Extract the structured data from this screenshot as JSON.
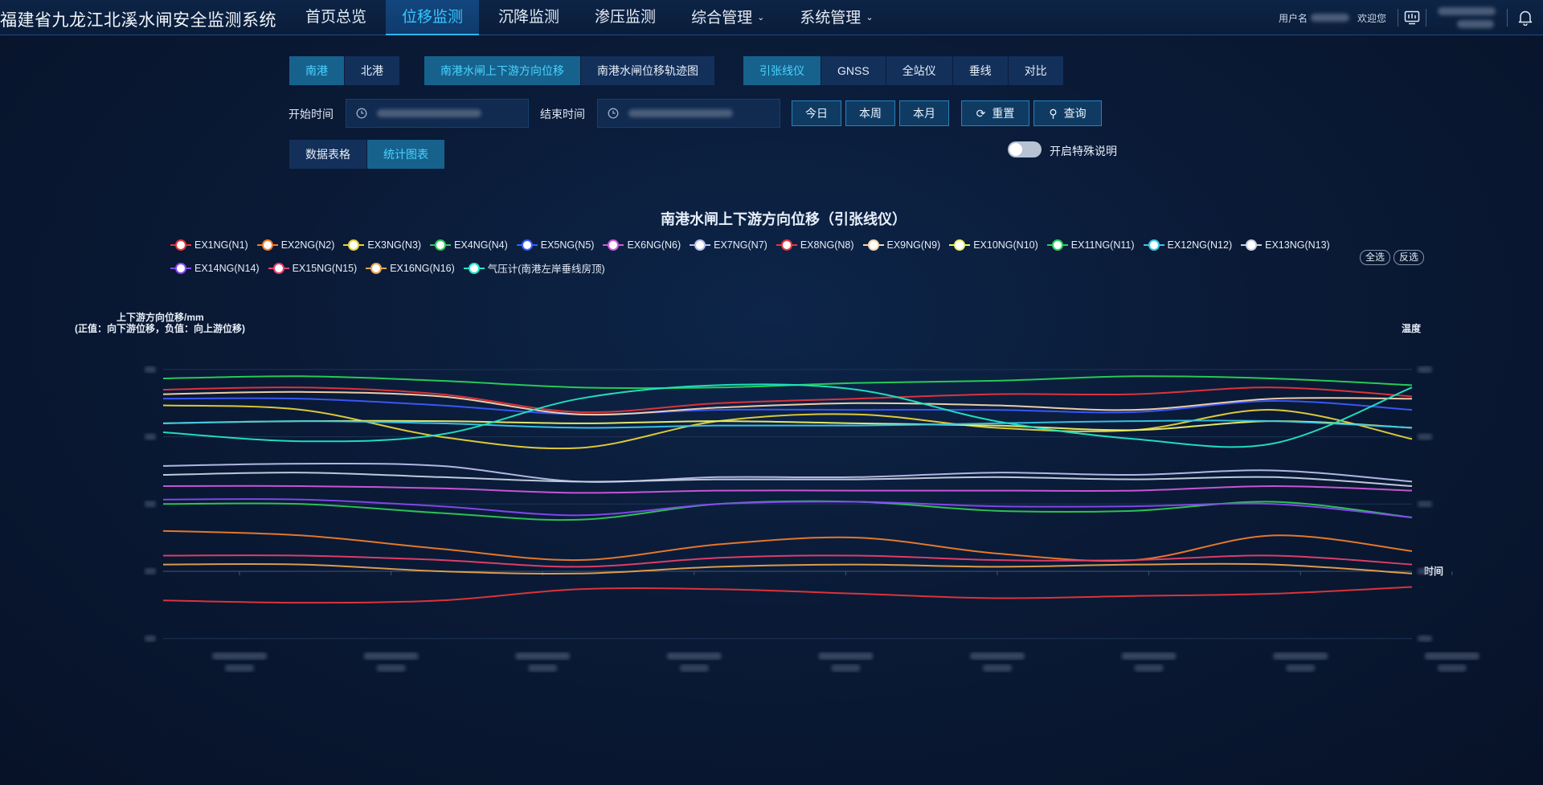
{
  "app": {
    "title": "福建省九龙江北溪水闸安全监测系统"
  },
  "nav": {
    "items": [
      {
        "label": "首页总览",
        "active": false,
        "dropdown": false
      },
      {
        "label": "位移监测",
        "active": true,
        "dropdown": false
      },
      {
        "label": "沉降监测",
        "active": false,
        "dropdown": false
      },
      {
        "label": "渗压监测",
        "active": false,
        "dropdown": false
      },
      {
        "label": "综合管理",
        "active": false,
        "dropdown": true
      },
      {
        "label": "系统管理",
        "active": false,
        "dropdown": true
      }
    ]
  },
  "header": {
    "user_label": "用户名",
    "welcome": "欢迎您",
    "icons": [
      "monitor-icon",
      "bell-icon"
    ]
  },
  "filters": {
    "port_tabs": [
      "南港",
      "北港"
    ],
    "port_active": 0,
    "view_tabs": [
      "南港水闸上下游方向位移",
      "南港水闸位移轨迹图"
    ],
    "view_active": 0,
    "instrument_tabs": [
      "引张线仪",
      "GNSS",
      "全站仪",
      "垂线",
      "对比"
    ],
    "instrument_active": 0,
    "start_label": "开始时间",
    "end_label": "结束时间",
    "quick_buttons": [
      "今日",
      "本周",
      "本月"
    ],
    "reset_label": "重置",
    "query_label": "查询",
    "display_tabs": [
      "数据表格",
      "统计图表"
    ],
    "display_active": 1,
    "toggle_label": "开启特殊说明",
    "toggle_on": false
  },
  "chart_data": {
    "type": "line",
    "title": "南港水闸上下游方向位移（引张线仪）",
    "ylabel": "上下游方向位移/mm",
    "ylabel_note": "(正值：向下游位移，负值：向上游位移)",
    "y2label": "温度",
    "xlabel": "时间",
    "grid": true,
    "legend_buttons": [
      "全选",
      "反选"
    ],
    "x_samples": 10,
    "series": [
      {
        "name": "EX1NG(N1)",
        "color": "#e8353b",
        "values": [
          0.81,
          0.82,
          0.79,
          0.71,
          0.75,
          0.77,
          0.79,
          0.79,
          0.82,
          0.78
        ]
      },
      {
        "name": "EX2NG(N2)",
        "color": "#f07c2a",
        "values": [
          0.18,
          0.16,
          0.1,
          0.05,
          0.12,
          0.15,
          0.08,
          0.05,
          0.16,
          0.09
        ]
      },
      {
        "name": "EX3NG(N3)",
        "color": "#e8d23a",
        "values": [
          0.74,
          0.72,
          0.6,
          0.55,
          0.67,
          0.7,
          0.64,
          0.63,
          0.72,
          0.59
        ]
      },
      {
        "name": "EX4NG(N4)",
        "color": "#2ec857",
        "values": [
          0.3,
          0.3,
          0.26,
          0.23,
          0.3,
          0.31,
          0.27,
          0.27,
          0.31,
          0.24
        ]
      },
      {
        "name": "EX5NG(N5)",
        "color": "#3b5bff",
        "values": [
          0.77,
          0.77,
          0.74,
          0.7,
          0.72,
          0.72,
          0.72,
          0.71,
          0.76,
          0.72
        ]
      },
      {
        "name": "EX6NG(N6)",
        "color": "#d05ad9",
        "values": [
          0.38,
          0.38,
          0.37,
          0.35,
          0.36,
          0.36,
          0.36,
          0.36,
          0.38,
          0.36
        ]
      },
      {
        "name": "EX7NG(N7)",
        "color": "#b9bfea",
        "values": [
          0.47,
          0.48,
          0.47,
          0.4,
          0.42,
          0.42,
          0.44,
          0.43,
          0.45,
          0.4
        ]
      },
      {
        "name": "EX8NG(N8)",
        "color": "#e8353b",
        "values": [
          -0.13,
          -0.14,
          -0.13,
          -0.08,
          -0.08,
          -0.1,
          -0.12,
          -0.11,
          -0.1,
          -0.07
        ]
      },
      {
        "name": "EX9NG(N9)",
        "color": "#f7d6b0",
        "values": [
          0.79,
          0.8,
          0.78,
          0.7,
          0.73,
          0.75,
          0.74,
          0.72,
          0.77,
          0.77
        ]
      },
      {
        "name": "EX10NG(N10)",
        "color": "#ecf26a",
        "values": [
          0.66,
          0.67,
          0.67,
          0.66,
          0.67,
          0.66,
          0.65,
          0.63,
          0.67,
          0.64
        ]
      },
      {
        "name": "EX11NG(N11)",
        "color": "#27d45a",
        "values": [
          0.86,
          0.87,
          0.85,
          0.82,
          0.82,
          0.84,
          0.85,
          0.87,
          0.86,
          0.83
        ]
      },
      {
        "name": "EX12NG(N12)",
        "color": "#38c7e8",
        "values": [
          0.66,
          0.67,
          0.66,
          0.64,
          0.65,
          0.65,
          0.66,
          0.67,
          0.67,
          0.64
        ]
      },
      {
        "name": "EX13NG(N13)",
        "color": "#c9d2e3",
        "values": [
          0.43,
          0.44,
          0.42,
          0.4,
          0.41,
          0.41,
          0.42,
          0.41,
          0.42,
          0.38
        ]
      },
      {
        "name": "EX14NG(N14)",
        "color": "#8649f0",
        "values": [
          0.32,
          0.32,
          0.29,
          0.25,
          0.3,
          0.31,
          0.29,
          0.29,
          0.3,
          0.24
        ]
      },
      {
        "name": "EX15NG(N15)",
        "color": "#e7406a",
        "values": [
          0.07,
          0.07,
          0.05,
          0.02,
          0.06,
          0.07,
          0.05,
          0.05,
          0.07,
          0.03
        ]
      },
      {
        "name": "EX16NG(N16)",
        "color": "#e6a24e",
        "values": [
          0.03,
          0.03,
          0.0,
          -0.01,
          0.02,
          0.03,
          0.02,
          0.03,
          0.03,
          -0.01
        ]
      },
      {
        "name": "气压计(南港左岸垂线房顶)",
        "color": "#22e6c4",
        "values": [
          0.62,
          0.58,
          0.61,
          0.77,
          0.83,
          0.81,
          0.67,
          0.59,
          0.57,
          0.82
        ]
      }
    ]
  }
}
